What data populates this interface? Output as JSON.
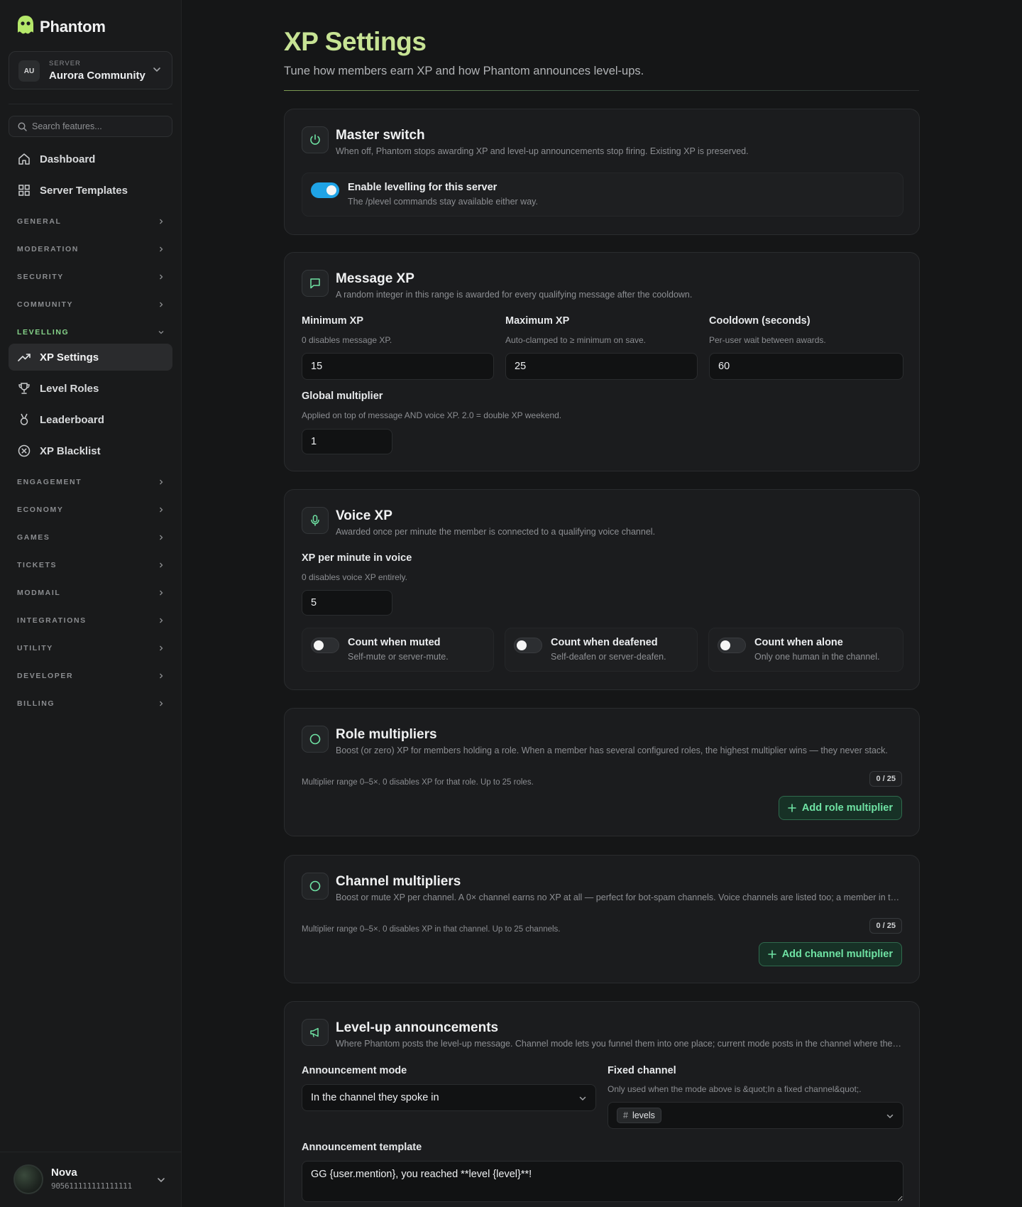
{
  "brand": {
    "name": "Phantom"
  },
  "server": {
    "label": "SERVER",
    "avatar": "AU",
    "name": "Aurora Community"
  },
  "search": {
    "placeholder": "Search features..."
  },
  "nav": {
    "top_items": [
      {
        "label": "Dashboard",
        "icon": "home-icon"
      },
      {
        "label": "Server Templates",
        "icon": "grid-icon"
      }
    ],
    "sections": [
      "GENERAL",
      "MODERATION",
      "SECURITY",
      "COMMUNITY",
      "LEVELLING",
      "ENGAGEMENT",
      "ECONOMY",
      "GAMES",
      "TICKETS",
      "MODMAIL",
      "INTEGRATIONS",
      "UTILITY",
      "DEVELOPER",
      "BILLING"
    ],
    "open_section": "LEVELLING",
    "levelling_items": [
      {
        "label": "XP Settings",
        "icon": "trending-up-icon",
        "active": true
      },
      {
        "label": "Level Roles",
        "icon": "trophy-icon"
      },
      {
        "label": "Leaderboard",
        "icon": "medal-icon"
      },
      {
        "label": "XP Blacklist",
        "icon": "x-circle-icon"
      }
    ]
  },
  "user": {
    "name": "Nova",
    "id": "905611111111111111"
  },
  "page": {
    "title": "XP Settings",
    "subtitle": "Tune how members earn XP and how Phantom announces level-ups."
  },
  "master": {
    "title": "Master switch",
    "desc": "When off, Phantom stops awarding XP and level-up announcements stop firing. Existing XP is preserved.",
    "toggle_title": "Enable levelling for this server",
    "toggle_sub": "The /plevel commands stay available either way.",
    "enabled": true
  },
  "message_xp": {
    "title": "Message XP",
    "desc": "A random integer in this range is awarded for every qualifying message after the cooldown.",
    "min_label": "Minimum XP",
    "min_help": "0 disables message XP.",
    "min_value": "15",
    "max_label": "Maximum XP",
    "max_help": "Auto-clamped to ≥ minimum on save.",
    "max_value": "25",
    "cooldown_label": "Cooldown (seconds)",
    "cooldown_help": "Per-user wait between awards.",
    "cooldown_value": "60",
    "mult_label": "Global multiplier",
    "mult_help": "Applied on top of message AND voice XP. 2.0 = double XP weekend.",
    "mult_value": "1"
  },
  "voice_xp": {
    "title": "Voice XP",
    "desc": "Awarded once per minute the member is connected to a qualifying voice channel.",
    "rate_label": "XP per minute in voice",
    "rate_help": "0 disables voice XP entirely.",
    "rate_value": "5",
    "toggles": [
      {
        "title": "Count when muted",
        "sub": "Self-mute or server-mute.",
        "on": false
      },
      {
        "title": "Count when deafened",
        "sub": "Self-deafen or server-deafen.",
        "on": false
      },
      {
        "title": "Count when alone",
        "sub": "Only one human in the channel.",
        "on": false
      }
    ]
  },
  "role_mult": {
    "title": "Role multipliers",
    "desc": "Boost (or zero) XP for members holding a role. When a member has several configured roles, the highest multiplier wins — they never stack.",
    "note": "Multiplier range 0–5×. 0 disables XP for that role. Up to 25 roles.",
    "count": "0 / 25",
    "add_label": "Add role multiplier"
  },
  "channel_mult": {
    "title": "Channel multipliers",
    "desc": "Boost or mute XP per channel. A 0× channel earns no XP at all — perfect for bot-spam channels. Voice channels are listed too; a member in them earns nothing.",
    "note": "Multiplier range 0–5×. 0 disables XP in that channel. Up to 25 channels.",
    "count": "0 / 25",
    "add_label": "Add channel multiplier"
  },
  "announce": {
    "title": "Level-up announcements",
    "desc": "Where Phantom posts the level-up message. Channel mode lets you funnel them into one place; current mode posts in the channel where the member levelled up.",
    "mode_label": "Announcement mode",
    "mode_value": "In the channel they spoke in",
    "channel_label": "Fixed channel",
    "channel_help": "Only used when the mode above is &quot;In a fixed channel&quot;.",
    "channel_value": "levels",
    "template_label": "Announcement template",
    "template_value": "GG {user.mention}, you reached **level {level}**!"
  },
  "colors": {
    "accent_title": "#c7e394",
    "toggle_on": "#1fa3e6",
    "add_button_text": "#6fe3a4",
    "levelling_section": "#86d48a"
  }
}
